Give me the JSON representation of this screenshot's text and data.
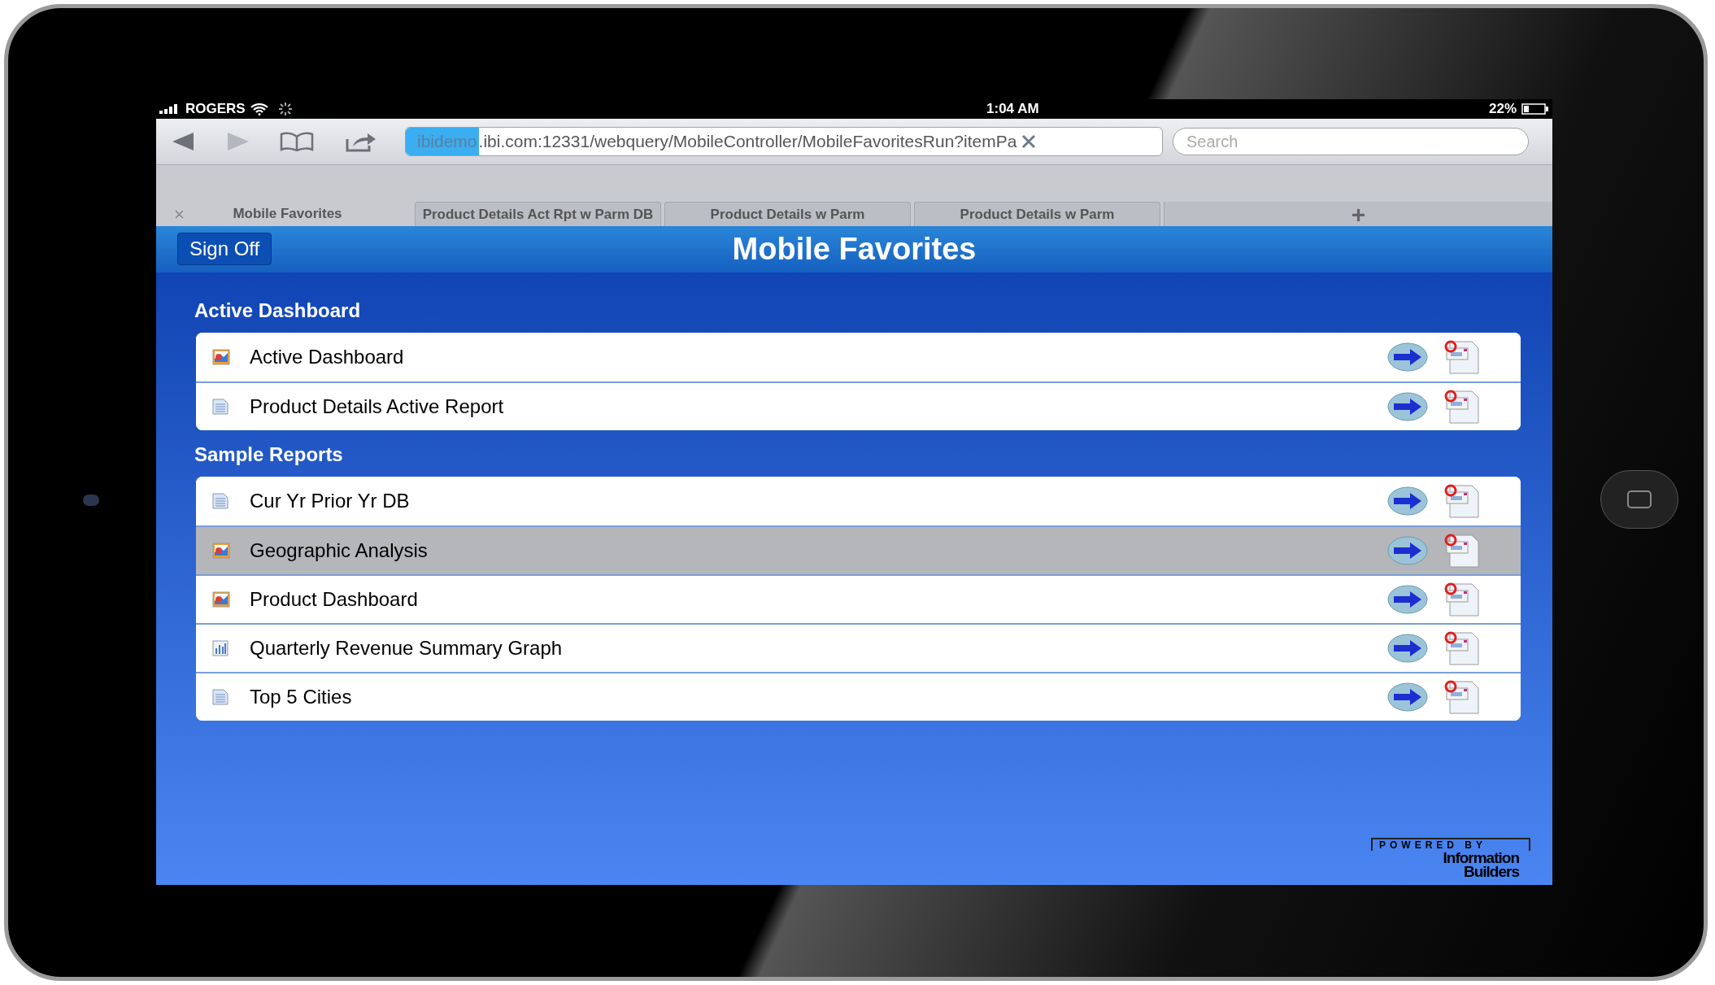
{
  "status_bar": {
    "carrier": "ROGERS",
    "time": "1:04 AM",
    "battery": "22%"
  },
  "browser": {
    "url_selected": "ibidemo",
    "url_rest": ".ibi.com:12331/webquery/MobileController/MobileFavoritesRun?itemPa",
    "search": {
      "placeholder": "Search"
    }
  },
  "tabs": [
    {
      "label": "Mobile Favorites",
      "selected": true,
      "close": "×"
    },
    {
      "label": "Product Details Act Rpt w Parm DB",
      "selected": false
    },
    {
      "label": "Product Details w Parm",
      "selected": false
    },
    {
      "label": "Product Details w Parm",
      "selected": false
    }
  ],
  "new_tab": "+",
  "header": {
    "button": "Sign Off",
    "title": "Mobile Favorites"
  },
  "sections": [
    {
      "title": "Active Dashboard",
      "items": [
        {
          "label": "Active Dashboard",
          "kind": "dashboard",
          "selected": false
        },
        {
          "label": "Product Details Active Report",
          "kind": "report",
          "selected": false
        }
      ]
    },
    {
      "title": "Sample Reports",
      "items": [
        {
          "label": "Cur Yr Prior Yr DB",
          "kind": "report",
          "selected": false
        },
        {
          "label": "Geographic Analysis",
          "kind": "dashboard",
          "selected": true
        },
        {
          "label": "Product Dashboard",
          "kind": "dashboard",
          "selected": false
        },
        {
          "label": "Quarterly Revenue Summary Graph",
          "kind": "graph",
          "selected": false
        },
        {
          "label": "Top 5 Cities",
          "kind": "report",
          "selected": false
        }
      ]
    }
  ],
  "footer": {
    "powered_by": "POWERED BY",
    "brand_line_1": "Information",
    "brand_line_2": "Builders"
  }
}
